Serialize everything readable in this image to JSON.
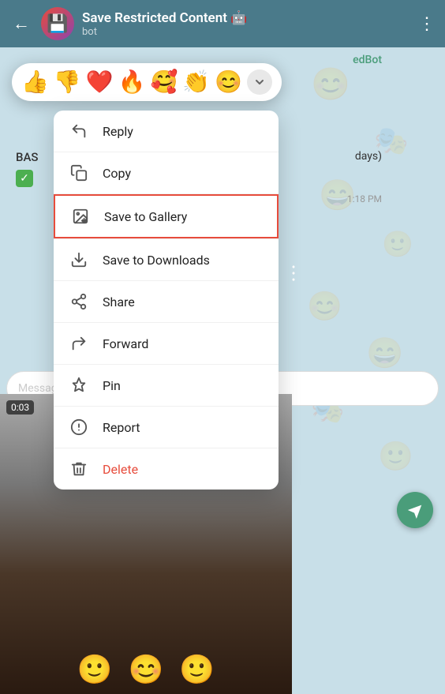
{
  "header": {
    "back_label": "←",
    "avatar_emoji": "💾",
    "title": "Save Restricted Content",
    "title_emoji": "🤖",
    "subtitle": "bot",
    "more_icon": "⋮"
  },
  "emoji_bar": {
    "reactions": [
      "👍",
      "👎",
      "❤️",
      "🔥",
      "🥰",
      "👏",
      "😊"
    ],
    "expand_icon": "⌄"
  },
  "context_menu": {
    "items": [
      {
        "id": "reply",
        "label": "Reply",
        "icon": "reply"
      },
      {
        "id": "copy",
        "label": "Copy",
        "icon": "copy"
      },
      {
        "id": "save-gallery",
        "label": "Save to Gallery",
        "icon": "save-gallery",
        "highlighted": true
      },
      {
        "id": "save-downloads",
        "label": "Save to Downloads",
        "icon": "save-downloads"
      },
      {
        "id": "share",
        "label": "Share",
        "icon": "share"
      },
      {
        "id": "forward",
        "label": "Forward",
        "icon": "forward"
      },
      {
        "id": "pin",
        "label": "Pin",
        "icon": "pin"
      },
      {
        "id": "report",
        "label": "Report",
        "icon": "report"
      },
      {
        "id": "delete",
        "label": "Delete",
        "icon": "delete",
        "danger": true
      }
    ]
  },
  "chat": {
    "edbot_label": "edBot",
    "bas_label": "BAS",
    "days_label": "days)",
    "message_time": "1:18 PM",
    "video_timer": "0:03",
    "figures": [
      "🙂",
      "😊",
      "🙂"
    ]
  }
}
